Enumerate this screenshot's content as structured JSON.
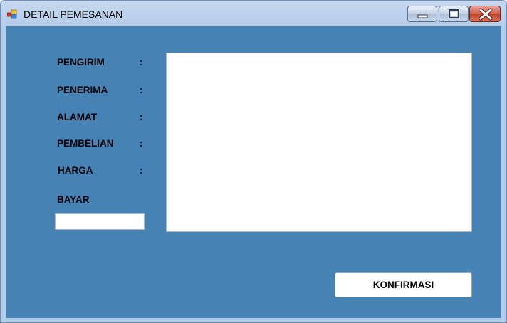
{
  "window": {
    "title": "DETAIL PEMESANAN",
    "icon": "windows-form-icon"
  },
  "title_buttons": {
    "minimize_icon": "minimize-icon",
    "maximize_icon": "maximize-icon",
    "close_icon": "close-icon"
  },
  "form": {
    "labels": {
      "pengirim": "PENGIRIM",
      "penerima": "PENERIMA",
      "alamat": "ALAMAT",
      "pembelian": "PEMBELIAN",
      "harga": "HARGA",
      "bayar": "BAYAR"
    },
    "colon": ":",
    "bayar_value": "",
    "details_text": "",
    "confirm_label": "KONFIRMASI"
  },
  "colors": {
    "form_background": "#4682b4",
    "title_bar": "#b4cbe8",
    "close_button": "#c0402a"
  }
}
